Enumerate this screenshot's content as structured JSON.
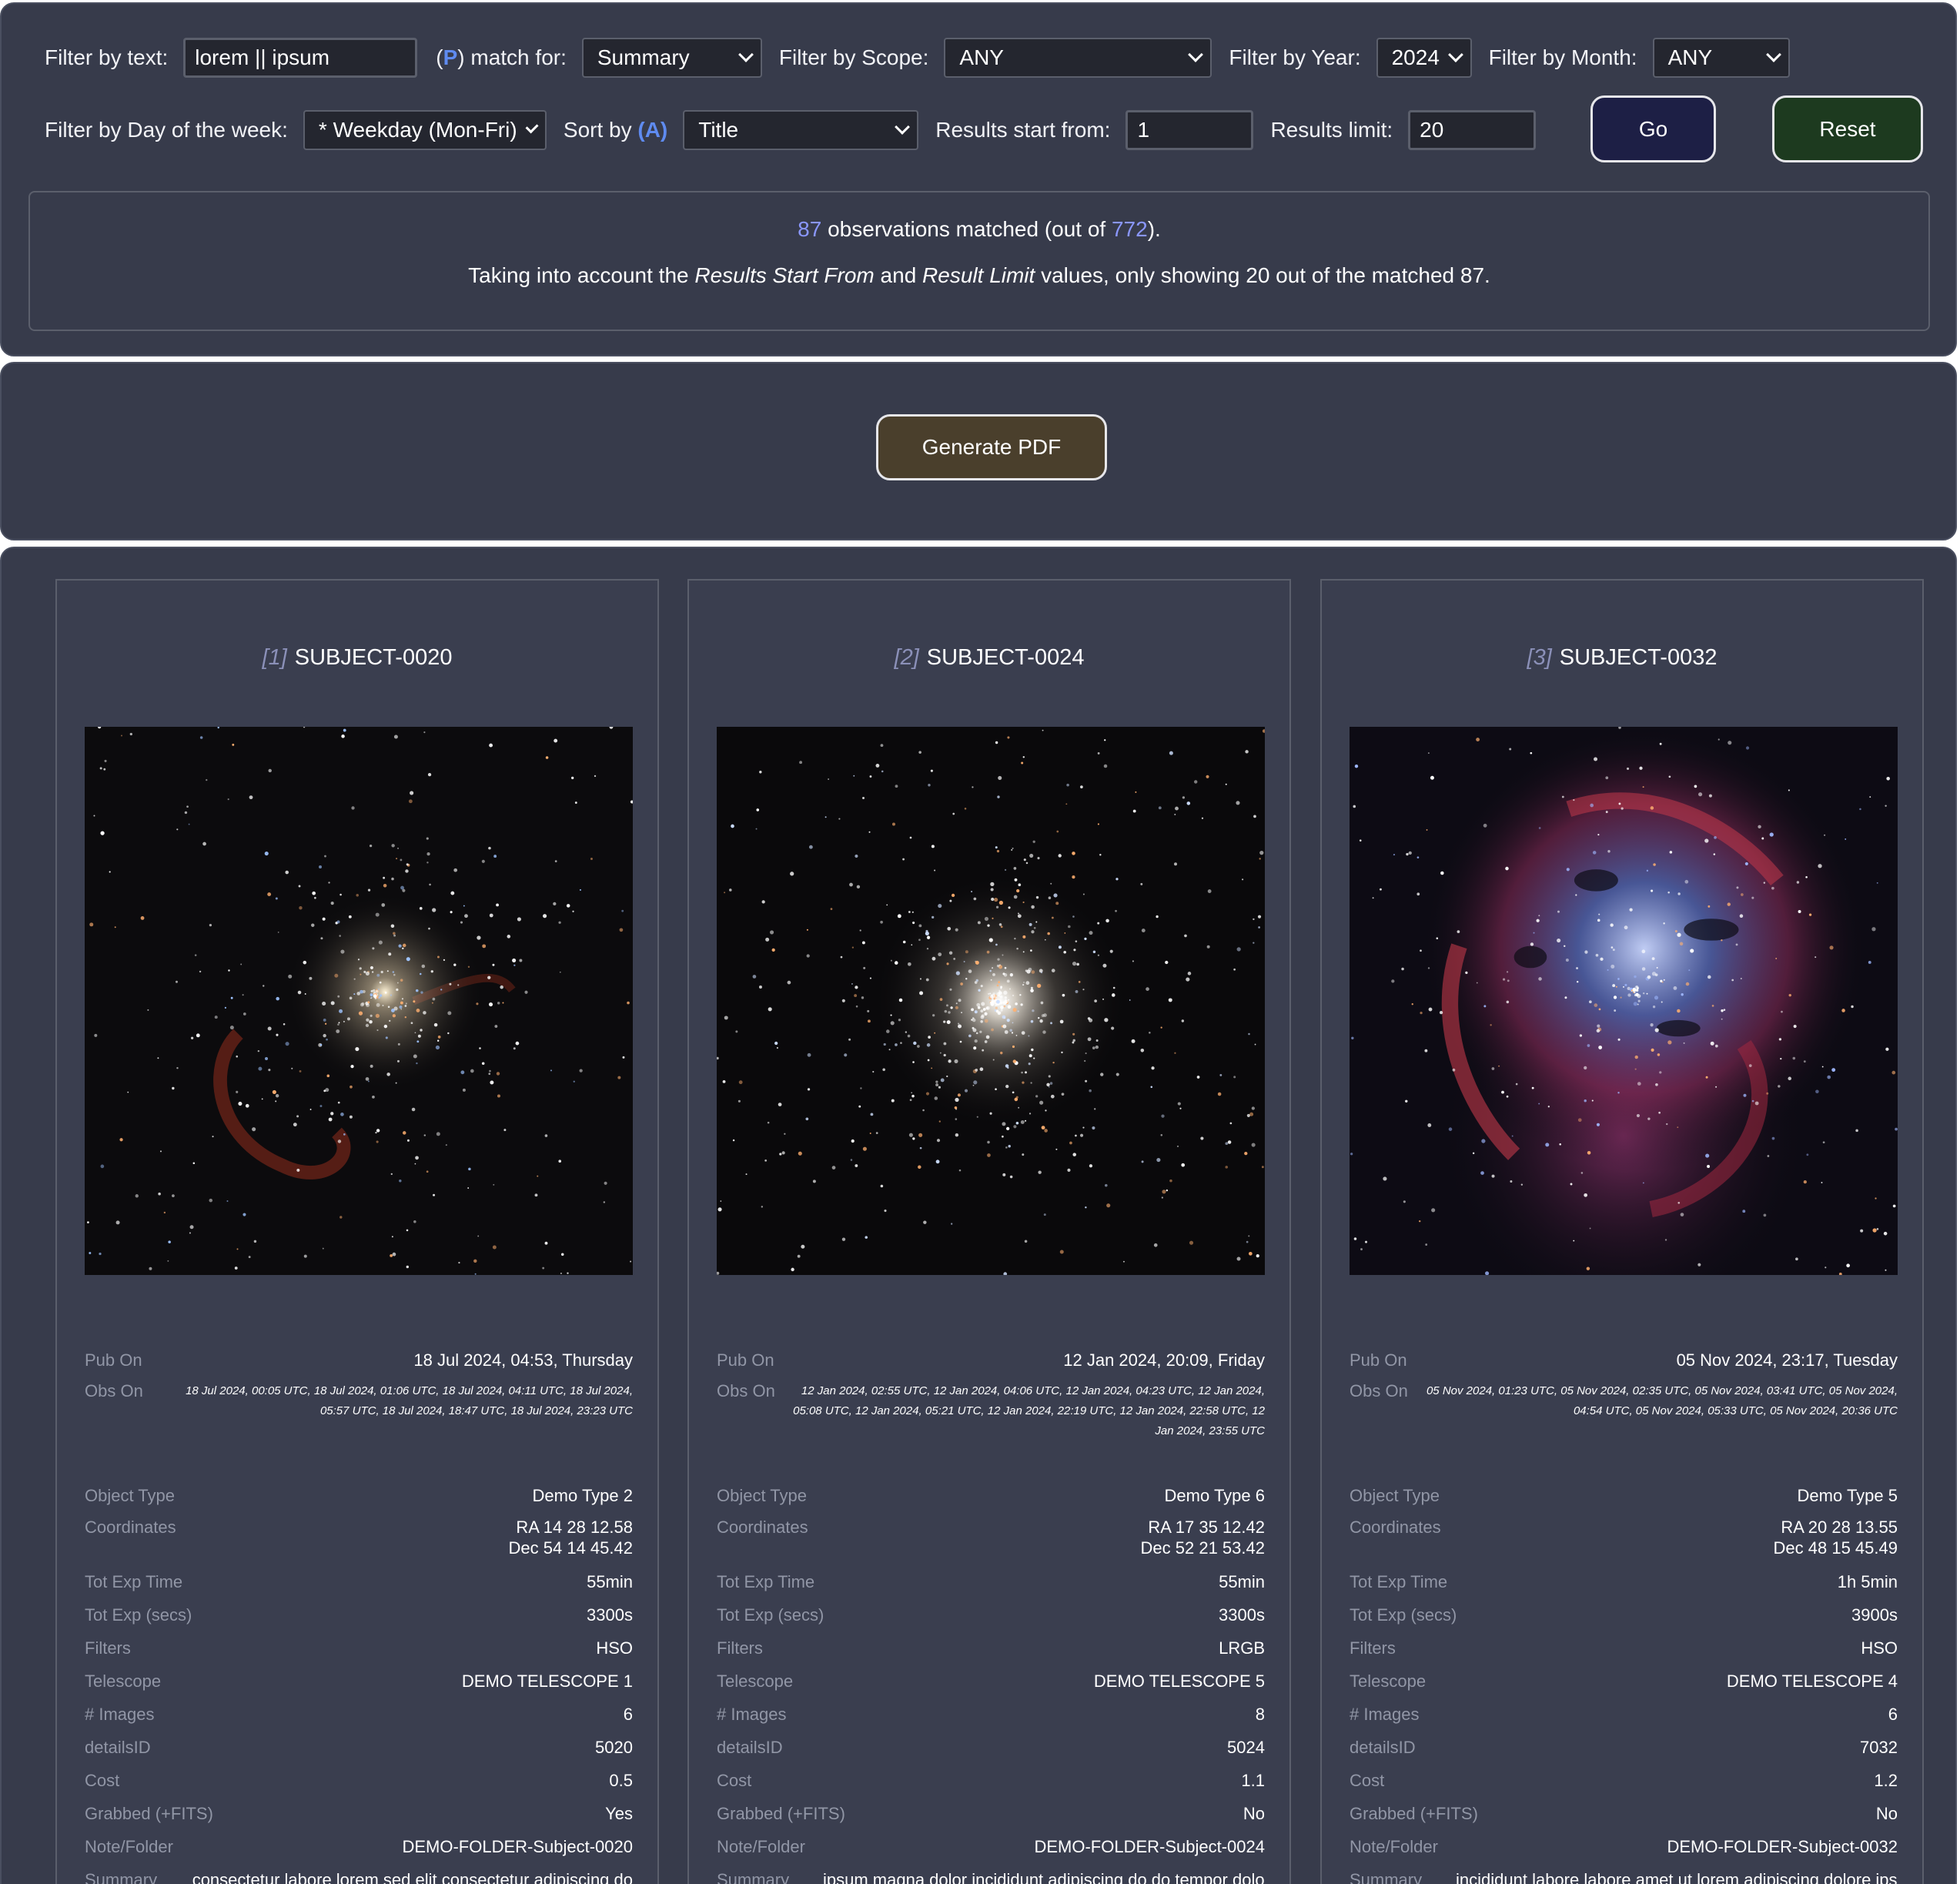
{
  "filters": {
    "text_label": "Filter by text:",
    "text_value": "lorem || ipsum",
    "match_paren_open": "(",
    "match_p": "P",
    "match_rest": ") match for:",
    "match_value": "Summary",
    "scope_label": "Filter by Scope:",
    "scope_value": "ANY",
    "year_label": "Filter by Year:",
    "year_value": "2024",
    "month_label": "Filter by Month:",
    "month_value": "ANY",
    "dow_label": "Filter by Day of the week:",
    "dow_value": "* Weekday (Mon-Fri)",
    "sort_label_pre": "Sort by ",
    "sort_a": "(A)",
    "sort_value": "Title",
    "start_label": "Results start from:",
    "start_value": "1",
    "limit_label": "Results limit:",
    "limit_value": "20",
    "go_label": "Go",
    "reset_label": "Reset"
  },
  "summary": {
    "matched": "87",
    "matched_text": " observations matched (out of ",
    "total": "772",
    "close": ").",
    "line2_a": "Taking into account the ",
    "line2_b": "Results Start From",
    "line2_c": " and ",
    "line2_d": "Result Limit",
    "line2_e": " values, only showing 20 out of the matched 87."
  },
  "pdf": {
    "label": "Generate PDF"
  },
  "labels": {
    "pub_on": "Pub On",
    "obs_on": "Obs On",
    "object_type": "Object Type",
    "coordinates": "Coordinates",
    "tot_exp_time": "Tot Exp Time",
    "tot_exp_secs": "Tot Exp (secs)",
    "filters": "Filters",
    "telescope": "Telescope",
    "images": "# Images",
    "details_id": "detailsID",
    "cost": "Cost",
    "grabbed": "Grabbed (+FITS)",
    "note_folder": "Note/Folder",
    "summary": "Summary"
  },
  "cards": [
    {
      "index": "[1]",
      "subject": "SUBJECT-0020",
      "pub_on": "18 Jul 2024, 04:53, Thursday",
      "obs_on": "18 Jul 2024, 00:05 UTC, 18 Jul 2024, 01:06 UTC, 18 Jul 2024, 04:11 UTC, 18 Jul 2024, 05:57 UTC, 18 Jul 2024, 18:47 UTC, 18 Jul 2024, 23:23 UTC",
      "object_type": "Demo Type 2",
      "ra": "RA 14 28 12.58",
      "dec": "Dec 54 14 45.42",
      "tot_exp_time": "55min",
      "tot_exp_secs": "3300s",
      "filters": "HSO",
      "telescope": "DEMO TELESCOPE 1",
      "images": "6",
      "details_id": "5020",
      "cost": "0.5",
      "grabbed": "Yes",
      "note_folder": "DEMO-FOLDER-Subject-0020",
      "summary": "consectetur labore lorem sed elit consectetur adipiscing do"
    },
    {
      "index": "[2]",
      "subject": "SUBJECT-0024",
      "pub_on": "12 Jan 2024, 20:09, Friday",
      "obs_on": "12 Jan 2024, 02:55 UTC, 12 Jan 2024, 04:06 UTC, 12 Jan 2024, 04:23 UTC, 12 Jan 2024, 05:08 UTC, 12 Jan 2024, 05:21 UTC, 12 Jan 2024, 22:19 UTC, 12 Jan 2024, 22:58 UTC, 12 Jan 2024, 23:55 UTC",
      "object_type": "Demo Type 6",
      "ra": "RA 17 35 12.42",
      "dec": "Dec 52 21 53.42",
      "tot_exp_time": "55min",
      "tot_exp_secs": "3300s",
      "filters": "LRGB",
      "telescope": "DEMO TELESCOPE 5",
      "images": "8",
      "details_id": "5024",
      "cost": "1.1",
      "grabbed": "No",
      "note_folder": "DEMO-FOLDER-Subject-0024",
      "summary": "ipsum magna dolor incididunt adipiscing do do tempor dolor"
    },
    {
      "index": "[3]",
      "subject": "SUBJECT-0032",
      "pub_on": "05 Nov 2024, 23:17, Tuesday",
      "obs_on": "05 Nov 2024, 01:23 UTC, 05 Nov 2024, 02:35 UTC, 05 Nov 2024, 03:41 UTC, 05 Nov 2024, 04:54 UTC, 05 Nov 2024, 05:33 UTC, 05 Nov 2024, 20:36 UTC",
      "object_type": "Demo Type 5",
      "ra": "RA 20 28 13.55",
      "dec": "Dec 48 15 45.49",
      "tot_exp_time": "1h 5min",
      "tot_exp_secs": "3900s",
      "filters": "HSO",
      "telescope": "DEMO TELESCOPE 4",
      "images": "6",
      "details_id": "7032",
      "cost": "1.2",
      "grabbed": "No",
      "note_folder": "DEMO-FOLDER-Subject-0032",
      "summary": "incididunt labore labore amet ut lorem adipiscing dolore ipsum"
    }
  ]
}
